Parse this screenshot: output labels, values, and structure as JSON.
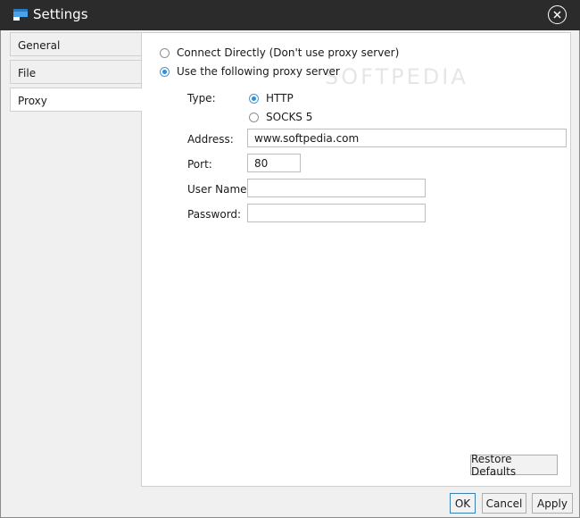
{
  "window": {
    "title": "Settings",
    "watermark": "SOFTPEDIA"
  },
  "tabs": [
    {
      "label": "General"
    },
    {
      "label": "File"
    },
    {
      "label": "Proxy"
    }
  ],
  "proxy": {
    "connect_directly": "Connect Directly (Don't use proxy server)",
    "use_proxy": "Use the following proxy server",
    "type_label": "Type:",
    "type_http": "HTTP",
    "type_socks": "SOCKS 5",
    "address_label": "Address:",
    "address_value": "www.softpedia.com",
    "port_label": "Port:",
    "port_value": "80",
    "username_label": "User Name:",
    "username_value": "",
    "password_label": "Password:",
    "password_value": ""
  },
  "buttons": {
    "restore_defaults": "Restore Defaults",
    "ok": "OK",
    "cancel": "Cancel",
    "apply": "Apply"
  },
  "colors": {
    "titlebar": "#2b2b2b",
    "accent": "#2e8fd6"
  }
}
